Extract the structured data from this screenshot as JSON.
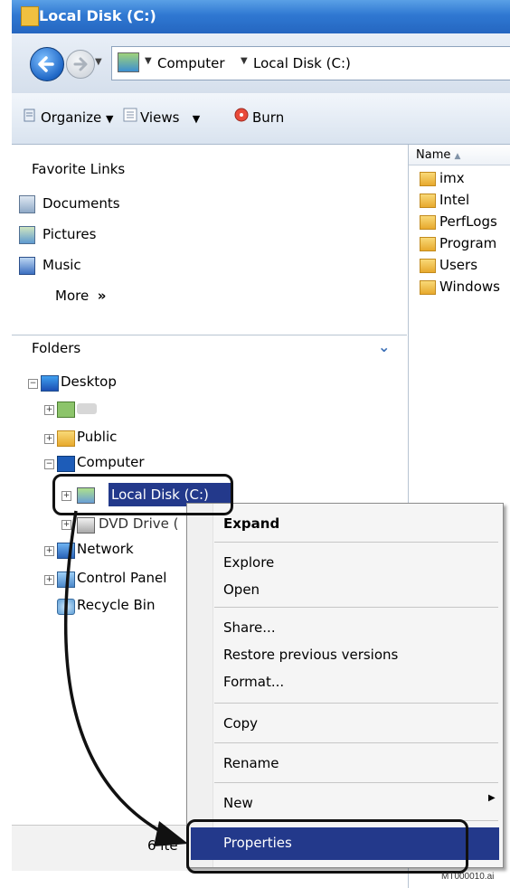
{
  "window": {
    "title": "Local Disk (C:)"
  },
  "address": {
    "crumbs": [
      "Computer",
      "Local Disk (C:)"
    ]
  },
  "toolbar": {
    "organize_label": "Organize",
    "views_label": "Views",
    "burn_label": "Burn"
  },
  "favorites": {
    "title": "Favorite Links",
    "items": [
      {
        "label": "Documents",
        "icon": "documents-icon"
      },
      {
        "label": "Pictures",
        "icon": "pictures-icon"
      },
      {
        "label": "Music",
        "icon": "music-icon"
      }
    ],
    "more_label": "More",
    "more_glyph": "»"
  },
  "folders": {
    "title": "Folders",
    "tree": [
      {
        "label": "Desktop",
        "level": 0
      },
      {
        "label": "",
        "level": 1
      },
      {
        "label": "Public",
        "level": 1
      },
      {
        "label": "Computer",
        "level": 1
      },
      {
        "label": "Local Disk (C:)",
        "level": 2
      },
      {
        "label": "DVD Drive (",
        "level": 2
      },
      {
        "label": "Network",
        "level": 1
      },
      {
        "label": "Control Panel",
        "level": 1
      },
      {
        "label": "Recycle Bin",
        "level": 1
      }
    ]
  },
  "file_list": {
    "column_name": "Name",
    "items": [
      "imx",
      "Intel",
      "PerfLogs",
      "Program",
      "Users",
      "Windows"
    ]
  },
  "status": {
    "text": "6 ite"
  },
  "context_menu": {
    "items": [
      "Expand",
      "Explore",
      "Open",
      "Share...",
      "Restore previous versions",
      "Format...",
      "Copy",
      "Rename",
      "New",
      "Properties"
    ],
    "highlight_color": "#23398b"
  },
  "watermark": "MT000010.ai"
}
